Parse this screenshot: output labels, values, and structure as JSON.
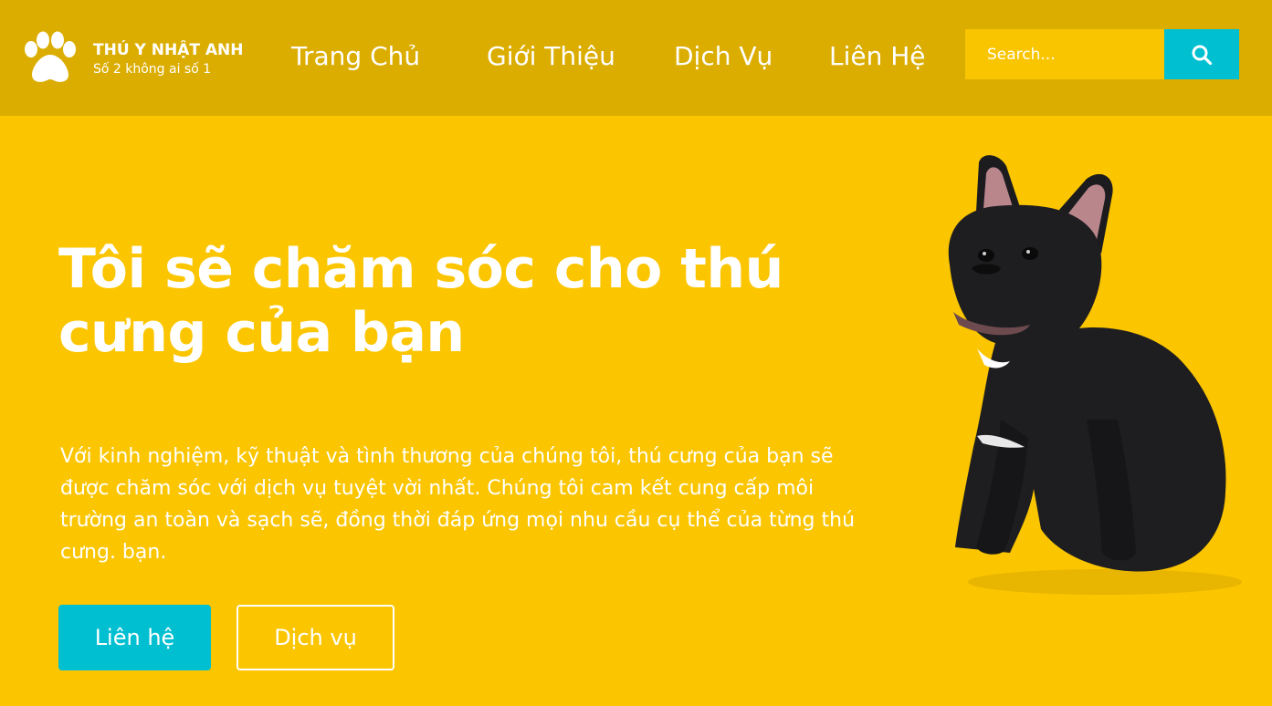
{
  "brand": {
    "name": "THÚ Y NHẬT ANH",
    "tagline": "Số 2 không ai số 1",
    "logo_icon": "paw-icon"
  },
  "nav": {
    "items": [
      {
        "label": "Trang Chủ"
      },
      {
        "label": "Giới Thiệu"
      },
      {
        "label": "Dịch Vụ"
      },
      {
        "label": "Liên Hệ"
      }
    ]
  },
  "search": {
    "placeholder": "Search...",
    "button_icon": "search-icon"
  },
  "hero": {
    "title": "Tôi sẽ chăm sóc cho thú cưng của bạn",
    "description": "Với kinh nghiệm, kỹ thuật và tình thương của chúng tôi, thú cưng của bạn sẽ được chăm sóc với dịch vụ tuyệt vời nhất. Chúng tôi cam kết cung cấp môi trường an toàn và sạch sẽ, đồng thời đáp ứng mọi nhu cầu cụ thể của từng thú cưng. bạn.",
    "primary_button": "Liên hệ",
    "secondary_button": "Dịch vụ",
    "image": "french-bulldog-photo"
  },
  "colors": {
    "header_bg": "#dbad00",
    "page_bg": "#fbc500",
    "accent": "#00bfd1",
    "text": "#ffffff"
  }
}
